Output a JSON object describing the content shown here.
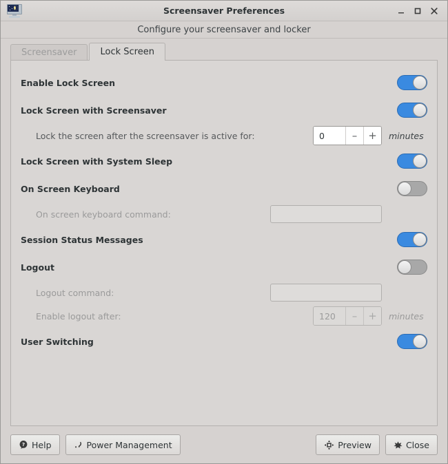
{
  "window": {
    "title": "Screensaver Preferences",
    "subtitle": "Configure your screensaver and locker",
    "icon": "screensaver-monitor-moon-icon",
    "controls": {
      "minimize": "minimize-icon",
      "maximize": "maximize-icon",
      "close": "close-icon"
    }
  },
  "tabs": [
    {
      "label": "Screensaver",
      "active": false
    },
    {
      "label": "Lock Screen",
      "active": true
    }
  ],
  "settings": [
    {
      "name": "enable-lock-screen",
      "label": "Enable Lock Screen",
      "control": "switch",
      "state": "on"
    },
    {
      "name": "lock-screen-with-screensaver",
      "label": "Lock Screen with Screensaver",
      "control": "switch",
      "state": "on"
    },
    {
      "name": "lock-screen-delay",
      "label": "Lock the screen after the screensaver is active for:",
      "control": "spinner",
      "value": "0",
      "units": "minutes",
      "decrement": "–",
      "increment": "+",
      "disabled": false
    },
    {
      "name": "lock-screen-with-system-sleep",
      "label": "Lock Screen with System Sleep",
      "control": "switch",
      "state": "on"
    },
    {
      "name": "on-screen-keyboard",
      "label": "On Screen Keyboard",
      "control": "switch",
      "state": "off"
    },
    {
      "name": "on-screen-keyboard-command",
      "label": "On screen keyboard command:",
      "control": "entry",
      "value": "",
      "placeholder": "",
      "disabled": true
    },
    {
      "name": "session-status-messages",
      "label": "Session Status Messages",
      "control": "switch",
      "state": "on"
    },
    {
      "name": "logout",
      "label": "Logout",
      "control": "switch",
      "state": "off"
    },
    {
      "name": "logout-command",
      "label": "Logout command:",
      "control": "entry",
      "value": "",
      "placeholder": "",
      "disabled": true
    },
    {
      "name": "enable-logout-after",
      "label": "Enable logout after:",
      "control": "spinner",
      "value": "120",
      "units": "minutes",
      "decrement": "–",
      "increment": "+",
      "disabled": true
    },
    {
      "name": "user-switching",
      "label": "User Switching",
      "control": "switch",
      "state": "on"
    }
  ],
  "actions": {
    "help": {
      "label": "Help",
      "icon": "help-question-icon"
    },
    "power_management": {
      "label": "Power Management",
      "icon": "power-plug-icon"
    },
    "preview": {
      "label": "Preview",
      "icon": "fullscreen-arrows-icon"
    },
    "close": {
      "label": "Close",
      "icon": "close-cross-icon"
    }
  },
  "colors": {
    "accent": "#3a8ae0",
    "switch_off": "#a8a8a8",
    "window_bg": "#d6d2d0",
    "panel_bg": "#d9d6d4",
    "text": "#2e3436",
    "text_disabled": "#9a9a9a"
  }
}
